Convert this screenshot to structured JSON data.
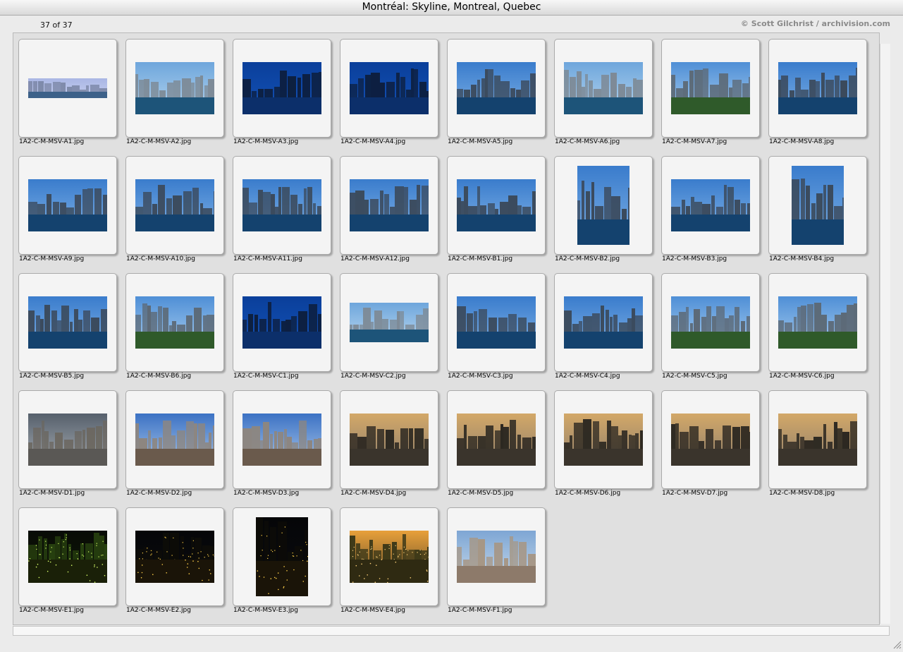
{
  "window": {
    "title": "Montréal: Skyline, Montreal, Quebec"
  },
  "header": {
    "count": "37 of 37",
    "credit": "© Scott Gilchrist / archivision.com"
  },
  "grid": {
    "items": [
      {
        "filename": "1A2-C-M-MSV-A1.jpg",
        "style": "haze"
      },
      {
        "filename": "1A2-C-M-MSV-A2.jpg",
        "style": "day-light"
      },
      {
        "filename": "1A2-C-M-MSV-A3.jpg",
        "style": "deep-blue"
      },
      {
        "filename": "1A2-C-M-MSV-A4.jpg",
        "style": "deep-blue"
      },
      {
        "filename": "1A2-C-M-MSV-A5.jpg",
        "style": "day"
      },
      {
        "filename": "1A2-C-M-MSV-A6.jpg",
        "style": "day-light"
      },
      {
        "filename": "1A2-C-M-MSV-A7.jpg",
        "style": "day-green"
      },
      {
        "filename": "1A2-C-M-MSV-A8.jpg",
        "style": "day"
      },
      {
        "filename": "1A2-C-M-MSV-A9.jpg",
        "style": "day"
      },
      {
        "filename": "1A2-C-M-MSV-A10.jpg",
        "style": "day"
      },
      {
        "filename": "1A2-C-M-MSV-A11.jpg",
        "style": "day"
      },
      {
        "filename": "1A2-C-M-MSV-A12.jpg",
        "style": "day"
      },
      {
        "filename": "1A2-C-M-MSV-B1.jpg",
        "style": "day"
      },
      {
        "filename": "1A2-C-M-MSV-B2.jpg",
        "style": "day"
      },
      {
        "filename": "1A2-C-M-MSV-B3.jpg",
        "style": "day"
      },
      {
        "filename": "1A2-C-M-MSV-B4.jpg",
        "style": "day"
      },
      {
        "filename": "1A2-C-M-MSV-B5.jpg",
        "style": "day"
      },
      {
        "filename": "1A2-C-M-MSV-B6.jpg",
        "style": "day-green"
      },
      {
        "filename": "1A2-C-M-MSV-C1.jpg",
        "style": "deep-blue"
      },
      {
        "filename": "1A2-C-M-MSV-C2.jpg",
        "style": "day-light"
      },
      {
        "filename": "1A2-C-M-MSV-C3.jpg",
        "style": "day"
      },
      {
        "filename": "1A2-C-M-MSV-C4.jpg",
        "style": "day"
      },
      {
        "filename": "1A2-C-M-MSV-C5.jpg",
        "style": "day-green"
      },
      {
        "filename": "1A2-C-M-MSV-C6.jpg",
        "style": "day-green"
      },
      {
        "filename": "1A2-C-M-MSV-D1.jpg",
        "style": "overcast"
      },
      {
        "filename": "1A2-C-M-MSV-D2.jpg",
        "style": "aerial"
      },
      {
        "filename": "1A2-C-M-MSV-D3.jpg",
        "style": "aerial"
      },
      {
        "filename": "1A2-C-M-MSV-D4.jpg",
        "style": "dusk"
      },
      {
        "filename": "1A2-C-M-MSV-D5.jpg",
        "style": "dusk"
      },
      {
        "filename": "1A2-C-M-MSV-D6.jpg",
        "style": "dusk"
      },
      {
        "filename": "1A2-C-M-MSV-D7.jpg",
        "style": "dusk"
      },
      {
        "filename": "1A2-C-M-MSV-D8.jpg",
        "style": "dusk"
      },
      {
        "filename": "1A2-C-M-MSV-E1.jpg",
        "style": "night-green"
      },
      {
        "filename": "1A2-C-M-MSV-E2.jpg",
        "style": "night"
      },
      {
        "filename": "1A2-C-M-MSV-E3.jpg",
        "style": "night"
      },
      {
        "filename": "1A2-C-M-MSV-E4.jpg",
        "style": "night-orange"
      },
      {
        "filename": "1A2-C-M-MSV-F1.jpg",
        "style": "aerial-light"
      }
    ]
  },
  "colors": {
    "deep-blue": {
      "sky": "#0a3f9a",
      "sky2": "#1452b8",
      "ground": "#0c2f6a",
      "bld": "#0d1f3f"
    },
    "day": {
      "sky": "#3a7ccc",
      "sky2": "#7cb0e6",
      "ground": "#14426e",
      "bld": "#3b4a5c"
    },
    "day-light": {
      "sky": "#6ea6dc",
      "sky2": "#b7d6ef",
      "ground": "#1d5479",
      "bld": "#7d8a96"
    },
    "day-green": {
      "sky": "#4f8fd6",
      "sky2": "#a8cdef",
      "ground": "#2f5a2a",
      "bld": "#5c6976"
    },
    "haze": {
      "sky": "#a9b6e4",
      "sky2": "#c6cff0",
      "ground": "#3d6189",
      "bld": "#7b86a6"
    },
    "overcast": {
      "sky": "#56606c",
      "sky2": "#a7adb3",
      "ground": "#5a5855",
      "bld": "#6b6760"
    },
    "aerial": {
      "sky": "#3c72c4",
      "sky2": "#a8c6ea",
      "ground": "#6a5a4c",
      "bld": "#8d8680"
    },
    "aerial-light": {
      "sky": "#7ea6d4",
      "sky2": "#c7d9ea",
      "ground": "#8d7a6a",
      "bld": "#a69786"
    },
    "dusk": {
      "sky": "#d3a868",
      "sky2": "#8f7f6c",
      "ground": "#3a342c",
      "bld": "#2a2620"
    },
    "night": {
      "sky": "#050608",
      "sky2": "#0b0b10",
      "ground": "#1a1408",
      "bld": "#0d0c08",
      "light": "#ffcf4a"
    },
    "night-green": {
      "sky": "#080b06",
      "sky2": "#101808",
      "ground": "#1a2008",
      "bld": "#27400f",
      "light": "#d9ff6a"
    },
    "night-orange": {
      "sky": "#e8a03a",
      "sky2": "#5e4a2a",
      "ground": "#2f2a12",
      "bld": "#3c3818",
      "light": "#ffd27a"
    }
  },
  "icons": {
    "resize": "resize-grip-icon"
  }
}
